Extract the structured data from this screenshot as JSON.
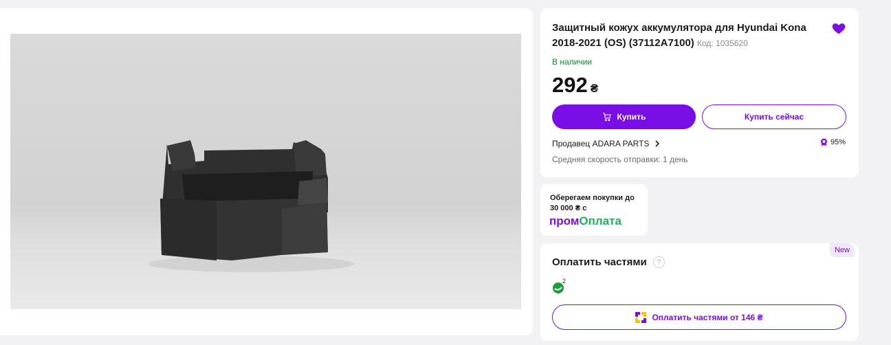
{
  "product": {
    "title": "Защитный кожух аккумулятора для Hyundai Kona 2018-2021 (OS) (37112A7100)",
    "code": "Код: 1035620",
    "availability": "В наличии",
    "price": "292",
    "currency": "₴",
    "image_alt": "black plastic battery cover"
  },
  "actions": {
    "buy_label": "Купить",
    "buy_now_label": "Купить сейчас"
  },
  "seller": {
    "label": "Продавец ADARA PARTS",
    "rating": "95%",
    "shipping_speed": "Средняя скорость отправки: 1 день"
  },
  "promo": {
    "text": "Оберегаем покупки до 30 000 ₴ с",
    "brand_part1": "пром",
    "brand_part2": "Оплата"
  },
  "installments": {
    "badge": "New",
    "title": "Оплатить частями",
    "help": "?",
    "bank_count": "2",
    "button_label": "Оплатить частями от 146 ₴"
  },
  "colors": {
    "accent": "#7a0ee6",
    "in_stock": "#0d8f2f",
    "promo_green": "#1ab45a"
  }
}
